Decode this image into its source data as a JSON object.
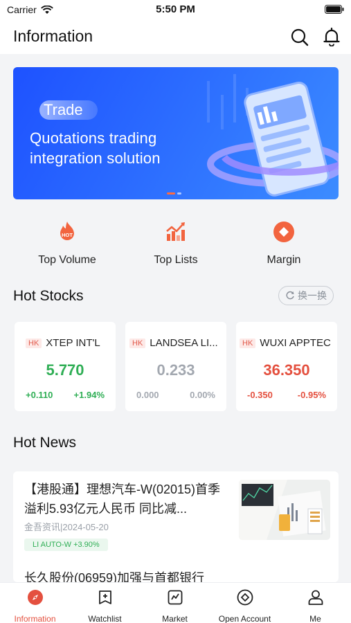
{
  "status": {
    "carrier": "Carrier",
    "time": "5:50 PM"
  },
  "header": {
    "title": "Information",
    "search_icon": "search-icon",
    "bell_icon": "bell-icon"
  },
  "banner": {
    "tag": "Trade",
    "line1": "Quotations trading",
    "line2": "integration solution",
    "slides": 2,
    "active_slide": 1
  },
  "quick_links": [
    {
      "label": "Top Volume",
      "icon": "hot-flame-icon",
      "badge": "HOT"
    },
    {
      "label": "Top Lists",
      "icon": "trend-chart-icon"
    },
    {
      "label": "Margin",
      "icon": "margin-diamond-icon"
    }
  ],
  "hot_stocks": {
    "title": "Hot Stocks",
    "swap_label": "换一换",
    "items": [
      {
        "market": "HK",
        "name": "XTEP INT'L",
        "price": "5.770",
        "change": "+0.110",
        "change_pct": "+1.94%",
        "trend": "up"
      },
      {
        "market": "HK",
        "name": "LANDSEA LI...",
        "price": "0.233",
        "change": "0.000",
        "change_pct": "0.00%",
        "trend": "flat"
      },
      {
        "market": "HK",
        "name": "WUXI APPTEC",
        "price": "36.350",
        "change": "-0.350",
        "change_pct": "-0.95%",
        "trend": "down"
      }
    ]
  },
  "hot_news": {
    "title": "Hot News",
    "items": [
      {
        "title": "【港股通】理想汽车-W(02015)首季溢利5.93亿元人民币 同比减...",
        "source_date": "金吾资讯|2024-05-20",
        "tag": "LI AUTO-W +3.90%"
      },
      {
        "title": "长久股份(06959)加强与首都银行"
      }
    ]
  },
  "tabs": [
    {
      "label": "Information",
      "icon": "compass-icon",
      "active": true
    },
    {
      "label": "Watchlist",
      "icon": "watchlist-icon",
      "active": false
    },
    {
      "label": "Market",
      "icon": "market-icon",
      "active": false
    },
    {
      "label": "Open Account",
      "icon": "open-account-icon",
      "active": false
    },
    {
      "label": "Me",
      "icon": "person-icon",
      "active": false
    }
  ],
  "colors": {
    "accent": "#e4503f",
    "up": "#2fae55",
    "down": "#e4503f",
    "flat": "#a3a8b0",
    "banner": "#2b6bff"
  }
}
